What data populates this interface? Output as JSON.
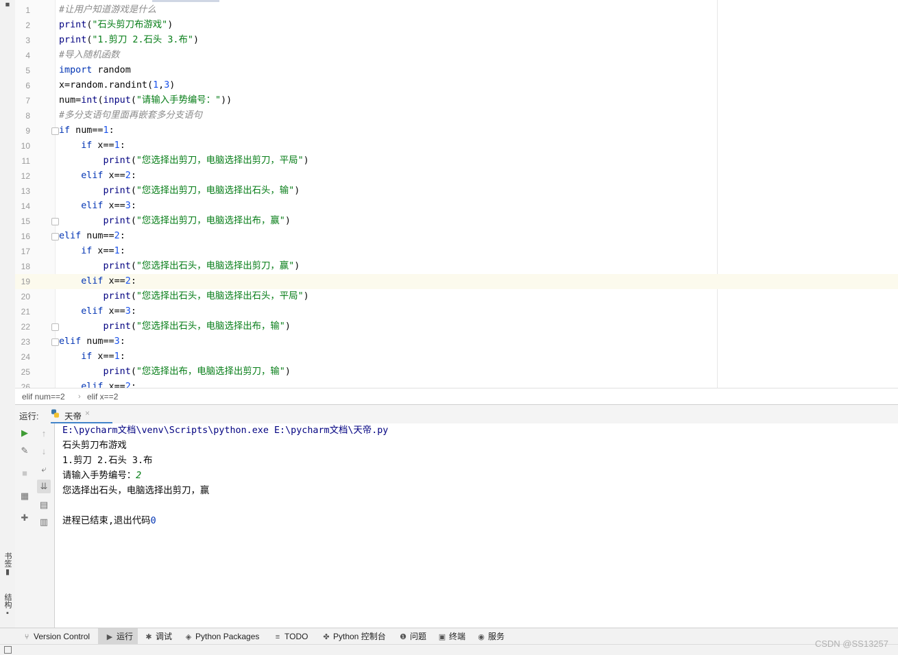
{
  "editor": {
    "lines": [
      {
        "n": "1",
        "tokens": [
          {
            "t": "#让用户知道游戏是什么",
            "c": "cmt"
          }
        ]
      },
      {
        "n": "2",
        "tokens": [
          {
            "t": "print",
            "c": "fn"
          },
          {
            "t": "(",
            "c": ""
          },
          {
            "t": "\"石头剪刀布游戏\"",
            "c": "str"
          },
          {
            "t": ")",
            "c": ""
          }
        ]
      },
      {
        "n": "3",
        "tokens": [
          {
            "t": "print",
            "c": "fn"
          },
          {
            "t": "(",
            "c": ""
          },
          {
            "t": "\"1.剪刀 2.石头 3.布\"",
            "c": "str"
          },
          {
            "t": ")",
            "c": ""
          }
        ]
      },
      {
        "n": "4",
        "tokens": [
          {
            "t": "#导入随机函数",
            "c": "cmt"
          }
        ]
      },
      {
        "n": "5",
        "tokens": [
          {
            "t": "import",
            "c": "kw"
          },
          {
            "t": " random",
            "c": ""
          }
        ]
      },
      {
        "n": "6",
        "tokens": [
          {
            "t": "x=random.randint(",
            "c": ""
          },
          {
            "t": "1",
            "c": "num"
          },
          {
            "t": ",",
            "c": ""
          },
          {
            "t": "3",
            "c": "num"
          },
          {
            "t": ")",
            "c": ""
          }
        ]
      },
      {
        "n": "7",
        "tokens": [
          {
            "t": "num=",
            "c": ""
          },
          {
            "t": "int",
            "c": "fn"
          },
          {
            "t": "(",
            "c": ""
          },
          {
            "t": "input",
            "c": "fn"
          },
          {
            "t": "(",
            "c": ""
          },
          {
            "t": "\"请输入手势编号：\"",
            "c": "str"
          },
          {
            "t": "))",
            "c": ""
          }
        ]
      },
      {
        "n": "8",
        "tokens": [
          {
            "t": "#多分支语句里面再嵌套多分支语句",
            "c": "cmt"
          }
        ]
      },
      {
        "n": "9",
        "fold": true,
        "tokens": [
          {
            "t": "if",
            "c": "kw"
          },
          {
            "t": " num==",
            "c": ""
          },
          {
            "t": "1",
            "c": "num"
          },
          {
            "t": ":",
            "c": ""
          }
        ]
      },
      {
        "n": "10",
        "tokens": [
          {
            "t": "    ",
            "c": ""
          },
          {
            "t": "if",
            "c": "kw"
          },
          {
            "t": " x==",
            "c": ""
          },
          {
            "t": "1",
            "c": "num"
          },
          {
            "t": ":",
            "c": ""
          }
        ]
      },
      {
        "n": "11",
        "tokens": [
          {
            "t": "        ",
            "c": ""
          },
          {
            "t": "print",
            "c": "fn"
          },
          {
            "t": "(",
            "c": ""
          },
          {
            "t": "\"您选择出剪刀，电脑选择出剪刀，平局\"",
            "c": "str"
          },
          {
            "t": ")",
            "c": ""
          }
        ]
      },
      {
        "n": "12",
        "tokens": [
          {
            "t": "    ",
            "c": ""
          },
          {
            "t": "elif",
            "c": "kw"
          },
          {
            "t": " x==",
            "c": ""
          },
          {
            "t": "2",
            "c": "num"
          },
          {
            "t": ":",
            "c": ""
          }
        ]
      },
      {
        "n": "13",
        "tokens": [
          {
            "t": "        ",
            "c": ""
          },
          {
            "t": "print",
            "c": "fn"
          },
          {
            "t": "(",
            "c": ""
          },
          {
            "t": "\"您选择出剪刀，电脑选择出石头，输\"",
            "c": "str"
          },
          {
            "t": ")",
            "c": ""
          }
        ]
      },
      {
        "n": "14",
        "tokens": [
          {
            "t": "    ",
            "c": ""
          },
          {
            "t": "elif",
            "c": "kw"
          },
          {
            "t": " x==",
            "c": ""
          },
          {
            "t": "3",
            "c": "num"
          },
          {
            "t": ":",
            "c": ""
          }
        ]
      },
      {
        "n": "15",
        "fold": true,
        "tokens": [
          {
            "t": "        ",
            "c": ""
          },
          {
            "t": "print",
            "c": "fn"
          },
          {
            "t": "(",
            "c": ""
          },
          {
            "t": "\"您选择出剪刀，电脑选择出布，赢\"",
            "c": "str"
          },
          {
            "t": ")",
            "c": ""
          }
        ]
      },
      {
        "n": "16",
        "fold": true,
        "tokens": [
          {
            "t": "elif",
            "c": "kw"
          },
          {
            "t": " num==",
            "c": ""
          },
          {
            "t": "2",
            "c": "num"
          },
          {
            "t": ":",
            "c": ""
          }
        ]
      },
      {
        "n": "17",
        "tokens": [
          {
            "t": "    ",
            "c": ""
          },
          {
            "t": "if",
            "c": "kw"
          },
          {
            "t": " x==",
            "c": ""
          },
          {
            "t": "1",
            "c": "num"
          },
          {
            "t": ":",
            "c": ""
          }
        ]
      },
      {
        "n": "18",
        "tokens": [
          {
            "t": "        ",
            "c": ""
          },
          {
            "t": "print",
            "c": "fn"
          },
          {
            "t": "(",
            "c": ""
          },
          {
            "t": "\"您选择出石头，电脑选择出剪刀，赢\"",
            "c": "str"
          },
          {
            "t": ")",
            "c": ""
          }
        ]
      },
      {
        "n": "19",
        "current": true,
        "tokens": [
          {
            "t": "    ",
            "c": ""
          },
          {
            "t": "elif",
            "c": "kw"
          },
          {
            "t": " x==",
            "c": ""
          },
          {
            "t": "2",
            "c": "num"
          },
          {
            "t": ":",
            "c": ""
          }
        ]
      },
      {
        "n": "20",
        "tokens": [
          {
            "t": "        ",
            "c": ""
          },
          {
            "t": "print",
            "c": "fn"
          },
          {
            "t": "(",
            "c": ""
          },
          {
            "t": "\"您选择出石头，电脑选择出石头，平局\"",
            "c": "str"
          },
          {
            "t": ")",
            "c": ""
          }
        ]
      },
      {
        "n": "21",
        "tokens": [
          {
            "t": "    ",
            "c": ""
          },
          {
            "t": "elif",
            "c": "kw"
          },
          {
            "t": " x==",
            "c": ""
          },
          {
            "t": "3",
            "c": "num"
          },
          {
            "t": ":",
            "c": ""
          }
        ]
      },
      {
        "n": "22",
        "fold": true,
        "tokens": [
          {
            "t": "        ",
            "c": ""
          },
          {
            "t": "print",
            "c": "fn"
          },
          {
            "t": "(",
            "c": ""
          },
          {
            "t": "\"您选择出石头，电脑选择出布，输\"",
            "c": "str"
          },
          {
            "t": ")",
            "c": ""
          }
        ]
      },
      {
        "n": "23",
        "fold": true,
        "tokens": [
          {
            "t": "elif",
            "c": "kw"
          },
          {
            "t": " num==",
            "c": ""
          },
          {
            "t": "3",
            "c": "num"
          },
          {
            "t": ":",
            "c": ""
          }
        ]
      },
      {
        "n": "24",
        "tokens": [
          {
            "t": "    ",
            "c": ""
          },
          {
            "t": "if",
            "c": "kw"
          },
          {
            "t": " x==",
            "c": ""
          },
          {
            "t": "1",
            "c": "num"
          },
          {
            "t": ":",
            "c": ""
          }
        ]
      },
      {
        "n": "25",
        "tokens": [
          {
            "t": "        ",
            "c": ""
          },
          {
            "t": "print",
            "c": "fn"
          },
          {
            "t": "(",
            "c": ""
          },
          {
            "t": "\"您选择出布，电脑选择出剪刀，输\"",
            "c": "str"
          },
          {
            "t": ")",
            "c": ""
          }
        ]
      },
      {
        "n": "26",
        "tokens": [
          {
            "t": "    ",
            "c": ""
          },
          {
            "t": "elif",
            "c": "kw"
          },
          {
            "t": " x==",
            "c": ""
          },
          {
            "t": "2",
            "c": "num"
          },
          {
            "t": ":",
            "c": ""
          }
        ]
      }
    ]
  },
  "breadcrumb": {
    "item1": "elif num==2",
    "separator": "›",
    "item2": "elif x==2"
  },
  "run_panel": {
    "label": "运行:",
    "tab_name": "天帝",
    "tab_close": "×"
  },
  "console": {
    "cmd": "E:\\pycharm文档\\venv\\Scripts\\python.exe E:\\pycharm文档\\天帝.py",
    "out1": "石头剪刀布游戏",
    "out2": "1.剪刀 2.石头 3.布",
    "prompt": "请输入手势编号：",
    "input": "2",
    "result": "您选择出石头，电脑选择出剪刀，赢",
    "exit_text": "进程已结束,退出代码",
    "exit_code": "0"
  },
  "left_strip": {
    "bookmarks": "书签",
    "structure": "结构"
  },
  "bottom_tabs": {
    "vcs": "Version Control",
    "run": "运行",
    "debug": "调试",
    "packages": "Python Packages",
    "todo": "TODO",
    "console": "Python 控制台",
    "problems": "问题",
    "terminal": "终端",
    "services": "服务"
  },
  "watermark": "CSDN @SS13257",
  "colors": {
    "keyword": "#0033b3",
    "string": "#067d17",
    "number": "#1750eb",
    "comment": "#8c8c8c",
    "current_line": "#fcfaed",
    "accent": "#4083c9"
  }
}
